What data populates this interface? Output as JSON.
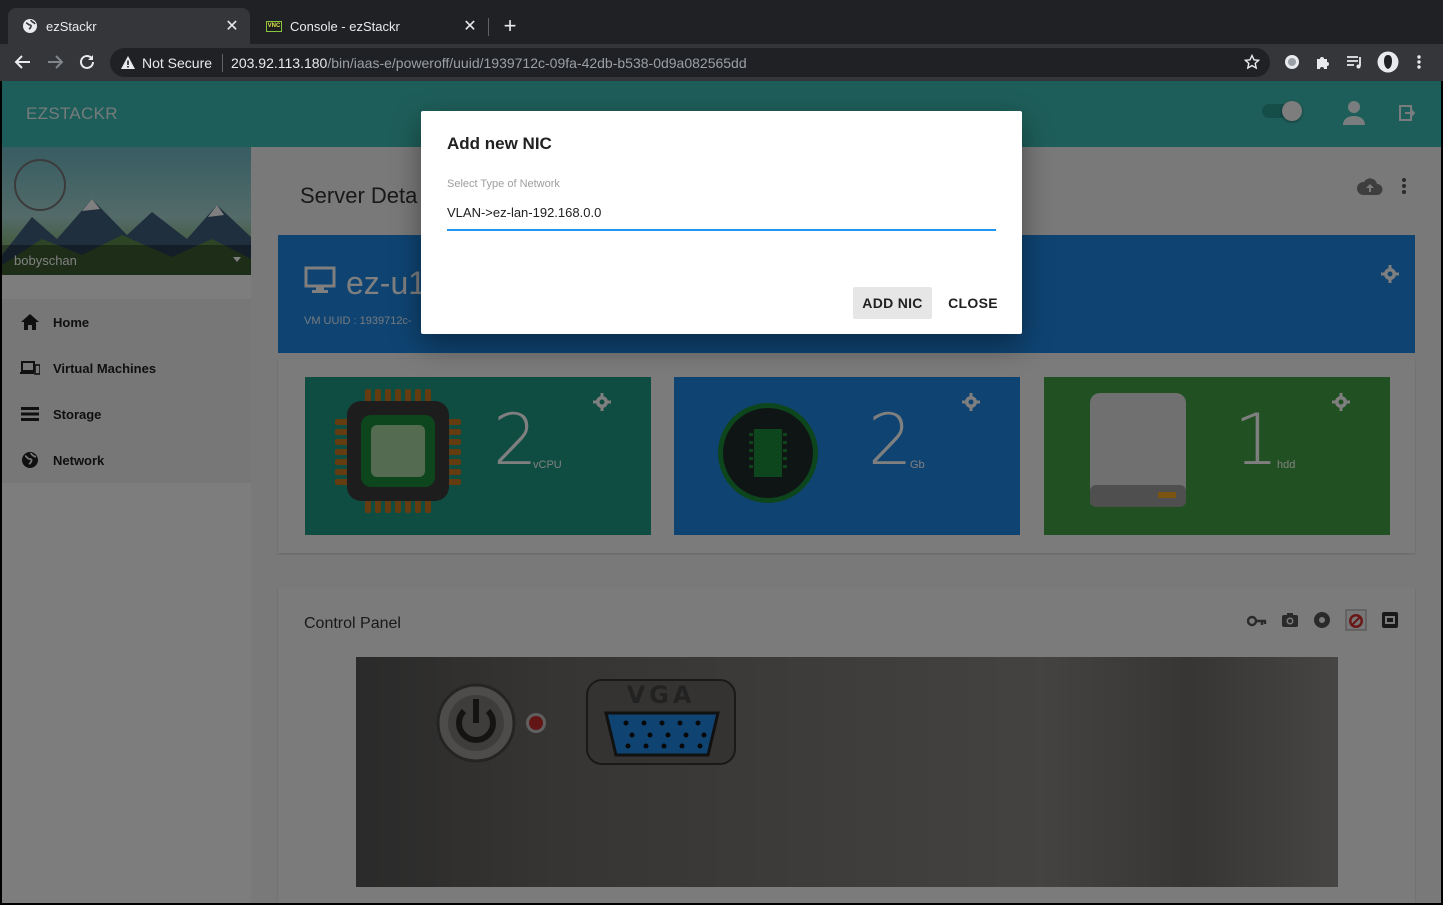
{
  "browser": {
    "tabs": [
      {
        "title": "ezStackr",
        "favicon": "globe-icon",
        "active": true
      },
      {
        "title": "Console - ezStackr",
        "favicon": "vnc-icon",
        "favicon_text": "VNC",
        "active": false
      }
    ],
    "address": {
      "security_label": "Not Secure",
      "host": "203.92.113.180",
      "path": "/bin/iaas-e/poweroff/uuid/1939712c-09fa-42db-b538-0d9a082565dd"
    }
  },
  "app": {
    "brand": "EZSTACKR",
    "user": "bobyschan",
    "menu": [
      {
        "label": "Home",
        "icon": "home-icon"
      },
      {
        "label": "Virtual Machines",
        "icon": "devices-icon"
      },
      {
        "label": "Storage",
        "icon": "storage-icon"
      },
      {
        "label": "Network",
        "icon": "globe-icon"
      }
    ],
    "page_title": "Server Deta",
    "vm": {
      "name": "ez-u1",
      "uuid_label": "VM UUID : 1939712c-"
    },
    "cards": [
      {
        "value": "2",
        "unit": "vCPU",
        "color": "#1e9a87"
      },
      {
        "value": "2",
        "unit": "Gb",
        "color": "#1e88e5"
      },
      {
        "value": "1",
        "unit": "hdd",
        "color": "#43a047"
      }
    ],
    "control_panel": {
      "title": "Control Panel",
      "vga_label": "VGA"
    }
  },
  "dialog": {
    "title": "Add new NIC",
    "field_label": "Select Type of Network",
    "field_value": "VLAN->ez-lan-192.168.0.0",
    "add_button": "ADD NIC",
    "close_button": "CLOSE"
  },
  "colors": {
    "appbar": "#3cbdb4",
    "accent": "#2196f3",
    "hero": "#1e88e5"
  }
}
